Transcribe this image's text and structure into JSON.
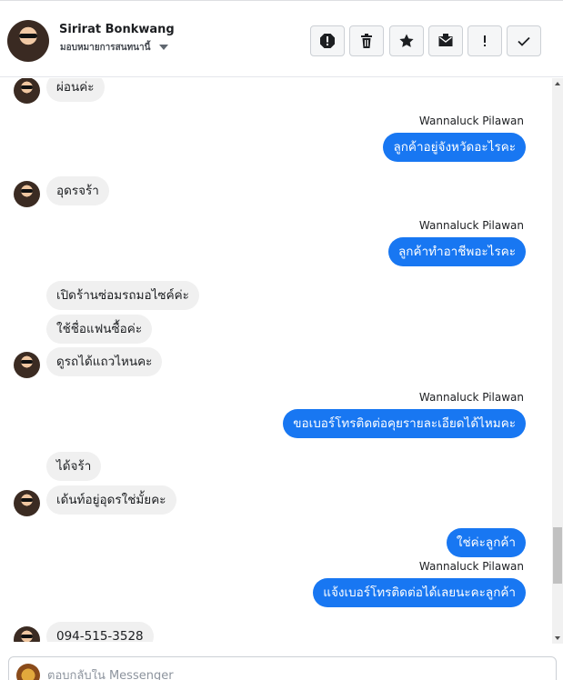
{
  "header": {
    "name": "Sirirat Bonkwang",
    "assign_label": "มอบหมายการสนทนานี้",
    "actions": [
      {
        "icon": "spam-report-icon"
      },
      {
        "icon": "trash-icon"
      },
      {
        "icon": "star-icon"
      },
      {
        "icon": "mark-unread-icon"
      },
      {
        "icon": "follow-up-icon"
      },
      {
        "icon": "done-check-icon"
      }
    ]
  },
  "colors": {
    "outgoing_bubble": "#1877f2",
    "incoming_bubble": "#f0f0f0",
    "scrollbar_thumb": "#c1c1c1"
  },
  "messages": [
    {
      "dir": "in",
      "text": "ผ่อนค่ะ"
    },
    {
      "dir": "out",
      "sender": "Wannaluck Pilawan",
      "text": "ลูกค้าอยู่จังหวัดอะไรคะ"
    },
    {
      "dir": "in",
      "text": "อุดรจร้า"
    },
    {
      "dir": "out",
      "sender": "Wannaluck Pilawan",
      "text": "ลูกค้าทำอาชีพอะไรคะ"
    },
    {
      "dir": "in",
      "text": "เปิดร้านซ่อมรถมอไซค์ค่ะ"
    },
    {
      "dir": "in",
      "text": "ใช้ชื่อแฟนซื้อค่ะ"
    },
    {
      "dir": "in",
      "text": "ดูรถได้แถวไหนคะ"
    },
    {
      "dir": "out",
      "sender": "Wannaluck Pilawan",
      "text": "ขอเบอร์โทรติดต่อคุยรายละเอียดได้ไหมคะ"
    },
    {
      "dir": "in",
      "text": "ได้จร้า"
    },
    {
      "dir": "in",
      "text": "เด้นท์อยู่อุดรใช่มั้ยคะ"
    },
    {
      "dir": "out",
      "text": "ใช่ค่ะลูกค้า"
    },
    {
      "dir": "out",
      "sender": "Wannaluck Pilawan",
      "text": "แจ้งเบอร์โทรติดต่อได้เลยนะคะลูกค้า"
    },
    {
      "dir": "in",
      "text": "094-515-3528"
    }
  ],
  "composer": {
    "placeholder": "ตอบกลับใน Messenger"
  }
}
